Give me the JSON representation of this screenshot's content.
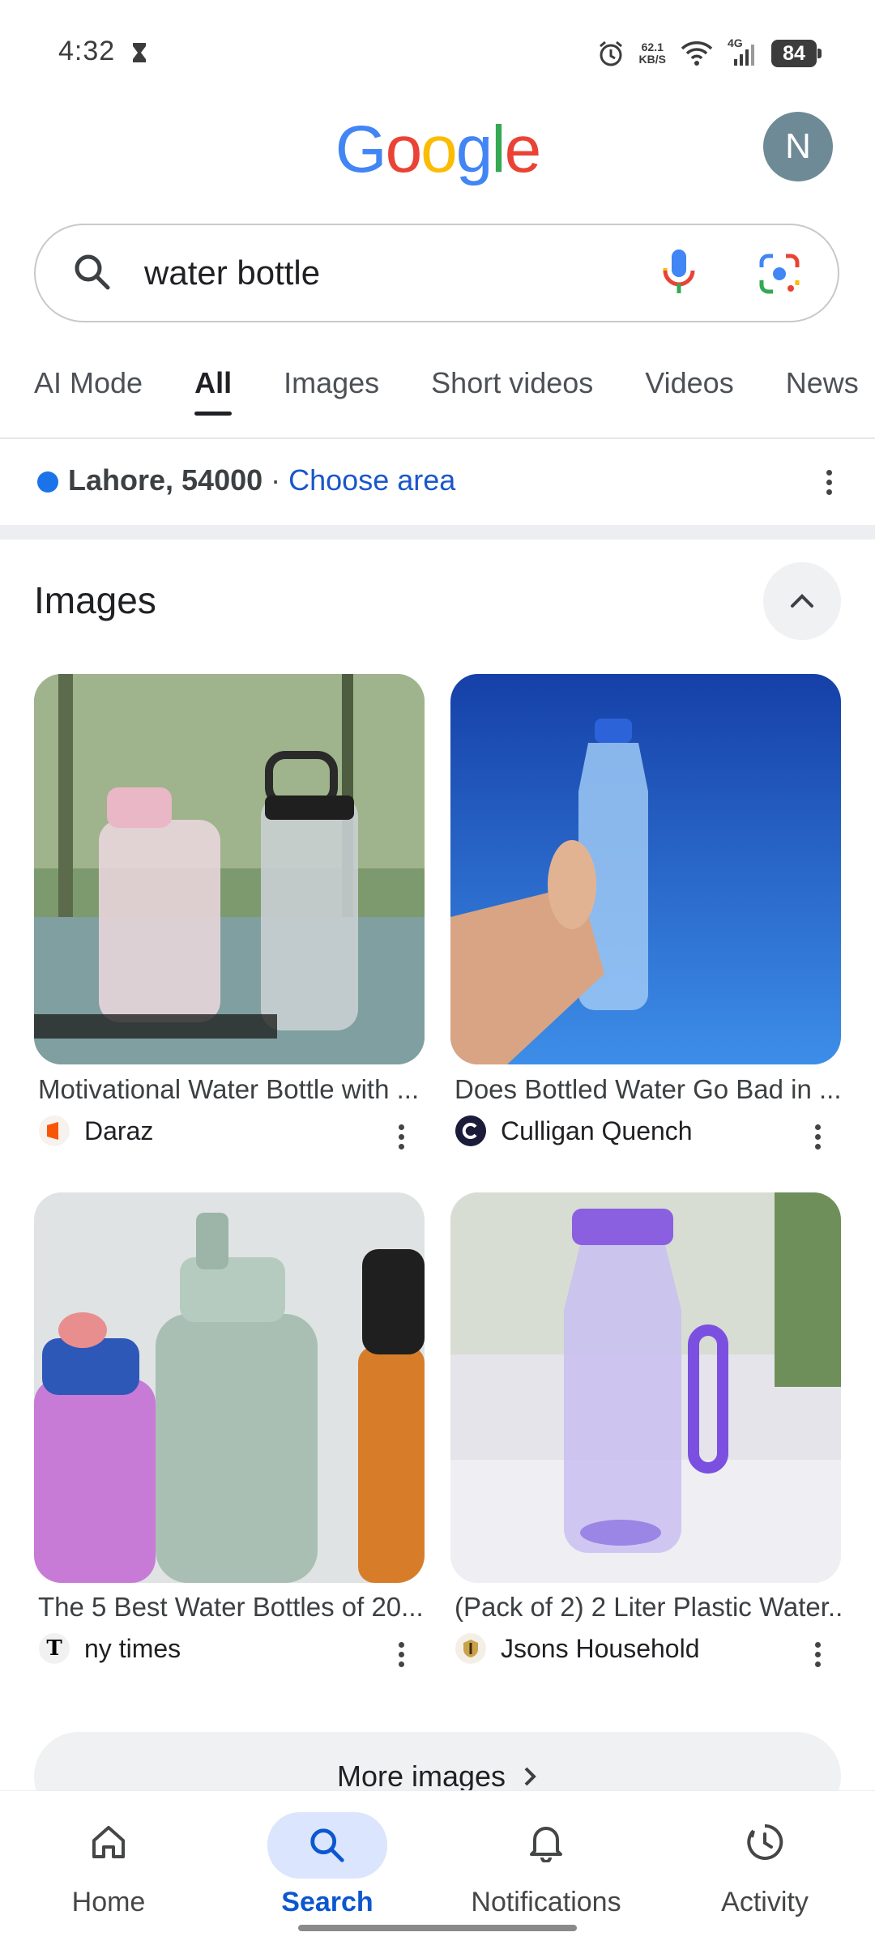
{
  "status_bar": {
    "time": "4:32",
    "net_speed_value": "62.1",
    "net_speed_unit": "KB/S",
    "network_type": "4G",
    "battery": "84"
  },
  "header": {
    "logo_letters": [
      {
        "char": "G",
        "color": "#4285F4"
      },
      {
        "char": "o",
        "color": "#EA4335"
      },
      {
        "char": "o",
        "color": "#FBBC05"
      },
      {
        "char": "g",
        "color": "#4285F4"
      },
      {
        "char": "l",
        "color": "#34A853"
      },
      {
        "char": "e",
        "color": "#EA4335"
      }
    ],
    "avatar_initial": "N"
  },
  "search": {
    "query": "water bottle"
  },
  "tabs": [
    {
      "label": "AI Mode",
      "active": false
    },
    {
      "label": "All",
      "active": true
    },
    {
      "label": "Images",
      "active": false
    },
    {
      "label": "Short videos",
      "active": false
    },
    {
      "label": "Videos",
      "active": false
    },
    {
      "label": "News",
      "active": false
    }
  ],
  "location": {
    "place": "Lahore, 54000",
    "separator": " · ",
    "link": "Choose area"
  },
  "images_section": {
    "title": "Images",
    "results": [
      {
        "title": "Motivational Water Bottle with ...",
        "source": "Daraz"
      },
      {
        "title": "Does Bottled Water Go Bad in ...",
        "source": "Culligan Quench"
      },
      {
        "title": "The 5 Best Water Bottles of 20...",
        "source": "ny times"
      },
      {
        "title": "(Pack of 2) 2 Liter Plastic Water...",
        "source": "Jsons Household"
      }
    ],
    "more_label": "More images"
  },
  "bottom_nav": [
    {
      "label": "Home",
      "active": false
    },
    {
      "label": "Search",
      "active": true
    },
    {
      "label": "Notifications",
      "active": false
    },
    {
      "label": "Activity",
      "active": false
    }
  ],
  "colors": {
    "accent": "#0b57d0",
    "link": "#1a57c9",
    "location_dot": "#1a73e8"
  }
}
